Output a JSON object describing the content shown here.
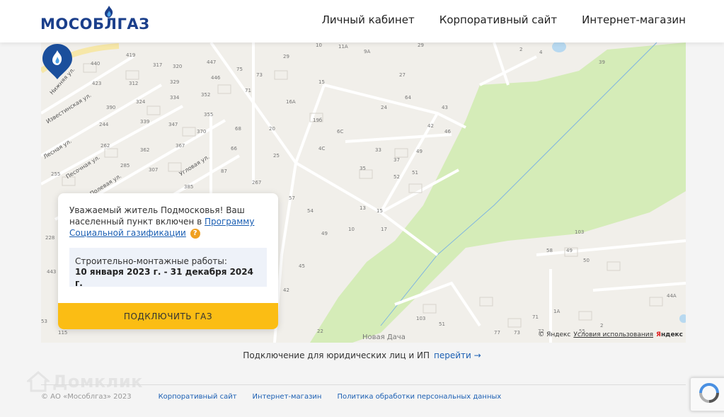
{
  "header": {
    "logo_text": "МОСОБЛГАЗ",
    "nav": [
      {
        "label": "Личный кабинет"
      },
      {
        "label": "Корпоративный сайт"
      },
      {
        "label": "Интернет-магазин"
      }
    ]
  },
  "map": {
    "streets": [
      "Нижняя ул.",
      "Известинская ул.",
      "Лесная ул.",
      "Песочная ул.",
      "Полевая ул.",
      "Угловая ул."
    ],
    "house_numbers": [
      "440",
      "423",
      "419",
      "317",
      "320",
      "447",
      "75",
      "73",
      "29",
      "10",
      "11А",
      "9А",
      "29",
      "2",
      "4",
      "39",
      "312",
      "329",
      "390",
      "324",
      "334",
      "352",
      "446",
      "71",
      "15",
      "16А",
      "27",
      "24",
      "64",
      "244",
      "339",
      "347",
      "355",
      "68",
      "20",
      "19б",
      "6С",
      "43",
      "262",
      "362",
      "367",
      "370",
      "66",
      "25",
      "4С",
      "33",
      "42",
      "46",
      "255",
      "285",
      "307",
      "87",
      "35",
      "37",
      "49",
      "267",
      "385",
      "52",
      "51",
      "228",
      "57",
      "54",
      "13",
      "15",
      "443",
      "49",
      "10",
      "17",
      "103",
      "45",
      "58",
      "49",
      "50",
      "42",
      "71",
      "1А",
      "44А",
      "103",
      "51",
      "22",
      "77",
      "73",
      "72",
      "55",
      "2",
      "53",
      "115"
    ],
    "place_label": "Новая Дача",
    "copyright": "© Яндекс",
    "terms_link": "Условия использования",
    "yandex_y": "Я",
    "yandex_rest": "ндекс"
  },
  "card": {
    "text_before": "Уважаемый житель Подмосковья! Ваш населенный пункт включен в ",
    "program_link": "Программу Социальной газификации",
    "help_icon": "?",
    "dates_label": "Строительно-монтажные работы:",
    "dates_value": "10 января 2023 г. - 31 декабря 2024 г.",
    "connect_button": "ПОДКЛЮЧИТЬ ГАЗ"
  },
  "legal": {
    "text": "Подключение для юридических лиц и ИП",
    "link": "перейти →"
  },
  "footer": {
    "copyright": "© АО «Мособлгаз» 2023",
    "links": [
      "Корпоративный сайт",
      "Интернет-магазин",
      "Политика обработки персональных данных"
    ]
  },
  "watermark": "Домклик",
  "colors": {
    "brand_blue": "#1b3f8b",
    "link_blue": "#1b5fb3",
    "button_yellow": "#fbbd14",
    "forest_green": "#d5ecb8"
  }
}
